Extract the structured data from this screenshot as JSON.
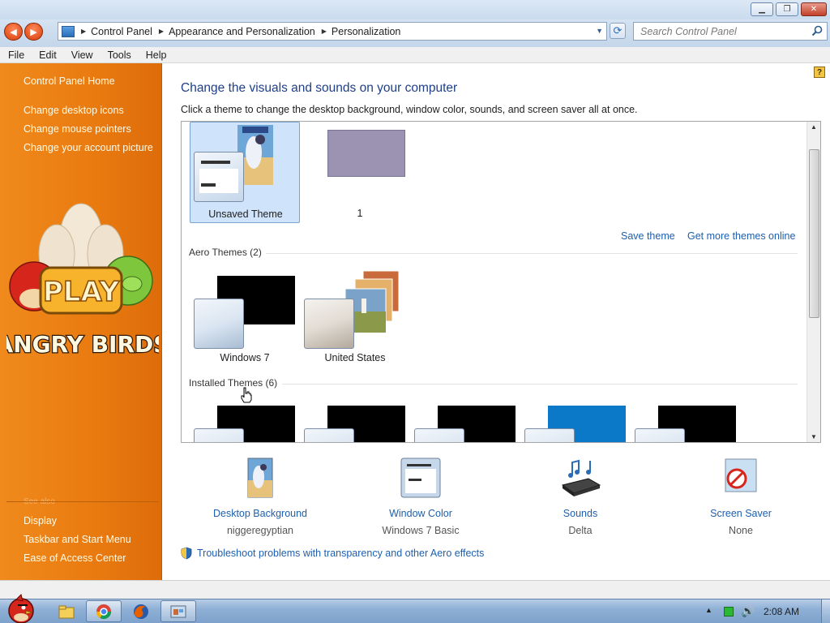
{
  "window": {
    "min_glyph": "▁",
    "max_glyph": "❐",
    "close_glyph": "✕"
  },
  "address": {
    "breadcrumbs": [
      "Control Panel",
      "Appearance and Personalization",
      "Personalization"
    ],
    "refresh_glyph": "⟳"
  },
  "search": {
    "placeholder": "Search Control Panel"
  },
  "menu": [
    "File",
    "Edit",
    "View",
    "Tools",
    "Help"
  ],
  "sidebar": {
    "home": "Control Panel Home",
    "links": [
      "Change desktop icons",
      "Change mouse pointers",
      "Change your account picture"
    ],
    "see_also": "See also",
    "see_also_links": [
      "Display",
      "Taskbar and Start Menu",
      "Ease of Access Center"
    ],
    "art": {
      "play_text": "PLAY",
      "logo_text": "ANGRY BIRDS"
    }
  },
  "main": {
    "title": "Change the visuals and sounds on your computer",
    "subtitle": "Click a theme to change the desktop background, window color, sounds, and screen saver all at once.",
    "help_glyph": "?",
    "my_themes": [
      {
        "label": "Unsaved Theme",
        "selected": true
      },
      {
        "label": "1",
        "selected": false,
        "color": "#9b93b1"
      }
    ],
    "save_theme": "Save theme",
    "more_themes": "Get more themes online",
    "aero_header": "Aero Themes (2)",
    "aero_themes": [
      {
        "label": "Windows 7"
      },
      {
        "label": "United States"
      }
    ],
    "installed_header": "Installed Themes (6)",
    "installed_thumbs": [
      "#000000",
      "#000000",
      "#000000",
      "#0b78c8",
      "#000000"
    ]
  },
  "customize": [
    {
      "title": "Desktop Background",
      "value": "niggeregyptian",
      "icon": "desktop-background-icon"
    },
    {
      "title": "Window Color",
      "value": "Windows 7 Basic",
      "icon": "window-color-icon"
    },
    {
      "title": "Sounds",
      "value": "Delta",
      "icon": "sounds-icon"
    },
    {
      "title": "Screen Saver",
      "value": "None",
      "icon": "screen-saver-icon"
    }
  ],
  "troubleshoot": "Troubleshoot problems with transparency and other Aero effects",
  "taskbar": {
    "clock": "2:08 AM",
    "tray_chevron": "▲",
    "speaker_glyph": "🔊",
    "pinned": [
      "explorer-icon",
      "chrome-icon",
      "firefox-icon",
      "control-panel-icon"
    ]
  },
  "colors": {
    "sidebar_orange": "#e97a10",
    "link_blue": "#1e5fad",
    "title_blue": "#1e3f8a",
    "selected_theme_bg": "#cfe3fa"
  }
}
